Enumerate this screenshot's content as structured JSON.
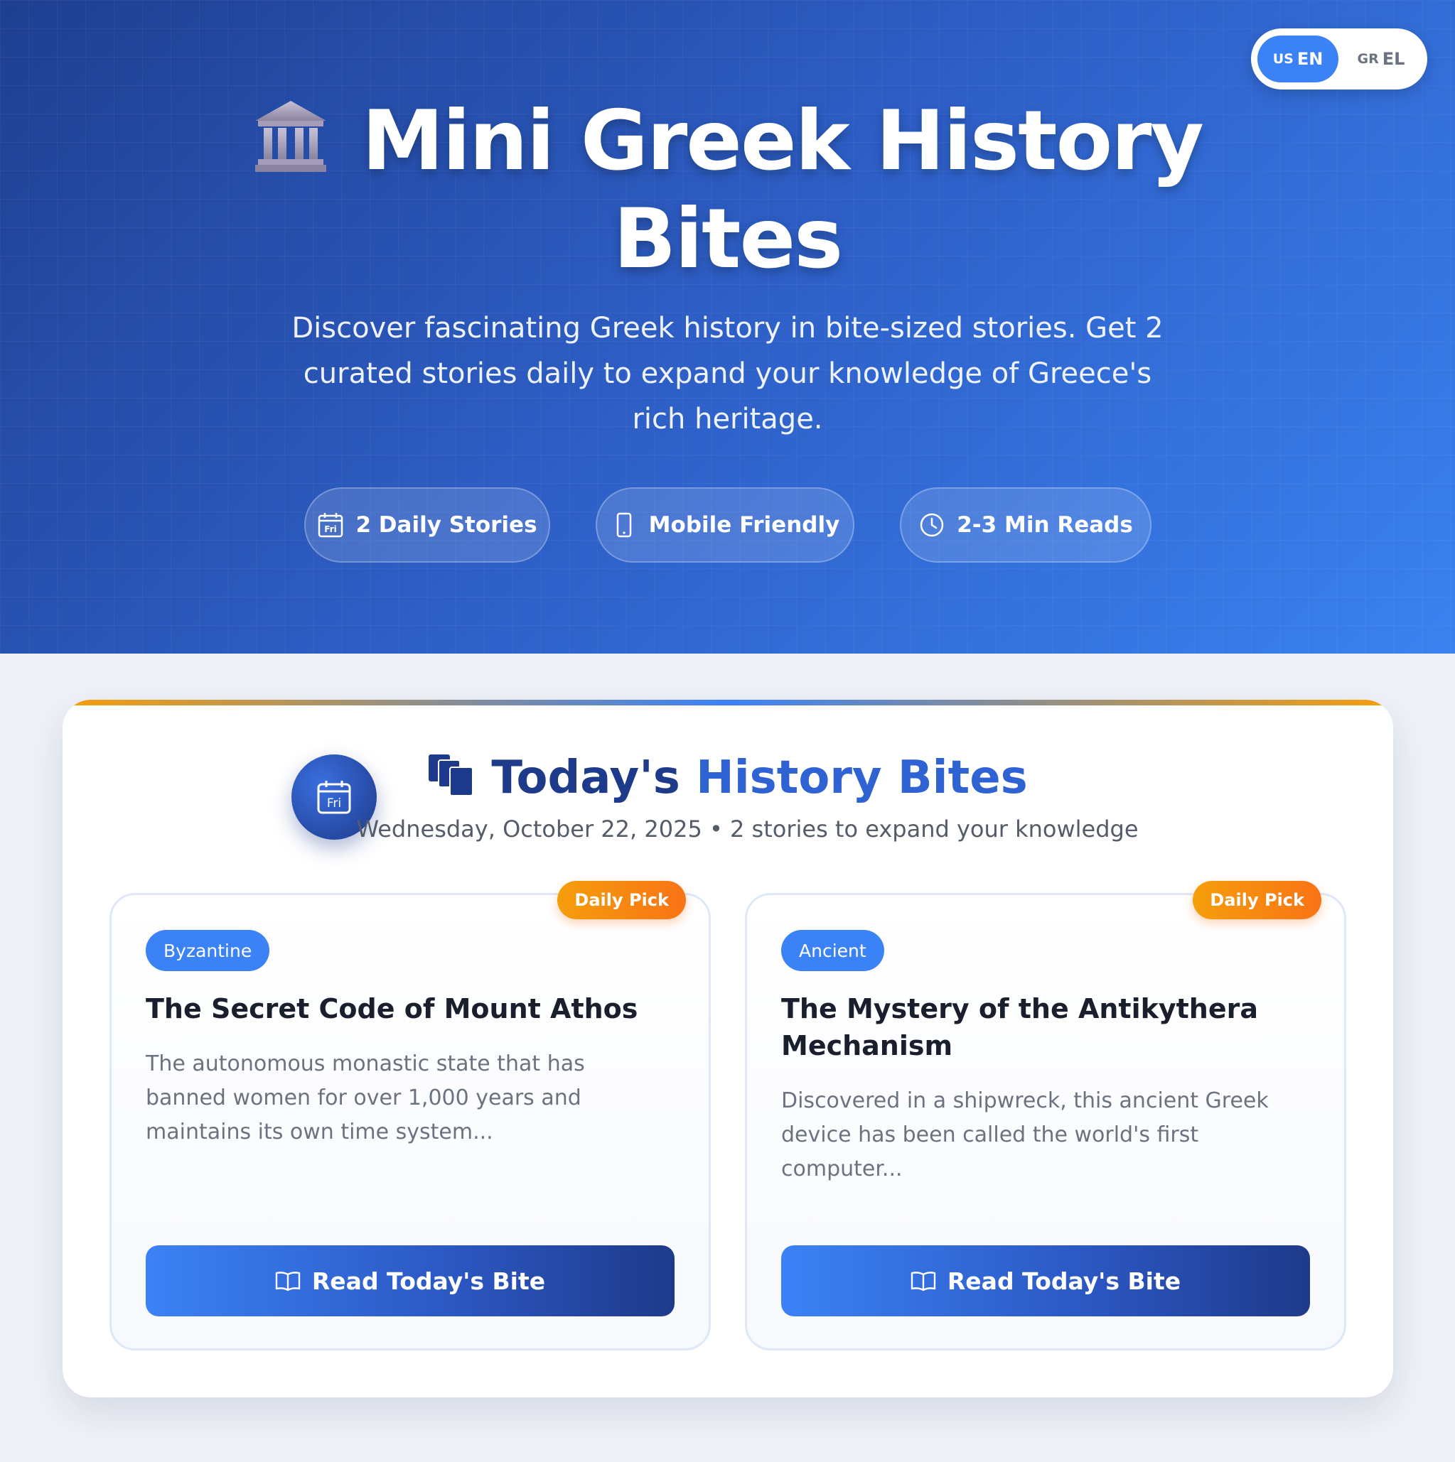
{
  "language_toggle": {
    "en": {
      "flag": "US",
      "label": "EN"
    },
    "el": {
      "flag": "GR",
      "label": "EL"
    }
  },
  "hero": {
    "title_line1": "Mini Greek History",
    "title_line2": "Bites",
    "subtitle": "Discover fascinating Greek history in bite-sized stories. Get 2 curated stories daily to expand your knowledge of Greece's rich heritage.",
    "features": [
      {
        "icon": "calendar-icon",
        "label": "2 Daily Stories",
        "calendar_text": "Fri"
      },
      {
        "icon": "phone-icon",
        "label": "Mobile Friendly"
      },
      {
        "icon": "clock-icon",
        "label": "2-3 Min Reads"
      }
    ]
  },
  "today": {
    "title_word1": "Today's",
    "title_rest": "History Bites",
    "subtitle": "Wednesday, October 22, 2025 • 2 stories to expand your knowledge",
    "calendar_text": "Fri"
  },
  "stories": [
    {
      "badge": "Daily Pick",
      "category": "Byzantine",
      "title": "The Secret Code of Mount Athos",
      "excerpt": "The autonomous monastic state that has banned women for over 1,000 years and maintains its own time system...",
      "button": "Read Today's Bite"
    },
    {
      "badge": "Daily Pick",
      "category": "Ancient",
      "title": "The Mystery of the Antikythera Mechanism",
      "excerpt": "Discovered in a shipwreck, this ancient Greek device has been called the world's first computer...",
      "button": "Read Today's Bite"
    }
  ],
  "colors": {
    "hero_start": "#1f3f91",
    "hero_end": "#3a82f0",
    "accent_blue": "#3b82f6",
    "navy": "#1e3a8a",
    "badge_orange": "#f97316"
  }
}
